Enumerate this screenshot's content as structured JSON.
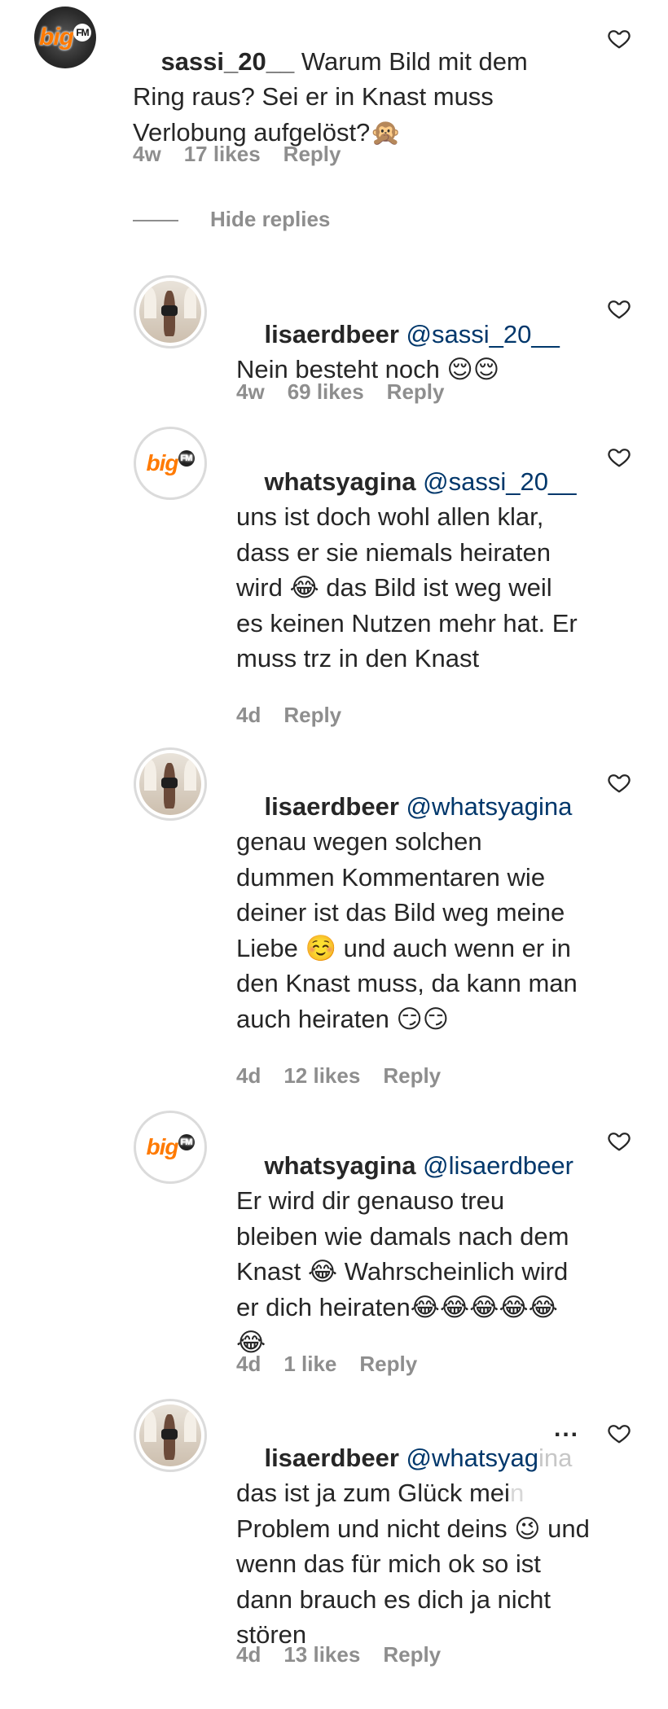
{
  "thread": {
    "root": {
      "username": "sassi_20__",
      "avatar_label": "big",
      "avatar_badge": "FM",
      "text": "Warum Bild mit dem Ring raus? Sei er in Knast muss Verlobung aufgelöst?🙊",
      "time": "4w",
      "likes": "17 likes",
      "reply": "Reply"
    },
    "hide_replies": "Hide replies",
    "replies": [
      {
        "username": "lisaerdbeer",
        "mention": "@sassi_20__",
        "text": "Nein besteht noch 😌😌",
        "time": "4w",
        "likes": "69 likes",
        "reply": "Reply"
      },
      {
        "username": "whatsyagina",
        "avatar_label": "big",
        "avatar_badge": "FM",
        "mention": "@sassi_20__",
        "text": "uns ist doch wohl allen klar, dass er sie niemals heiraten wird 😂 das Bild ist weg weil es keinen Nutzen mehr hat. Er muss trz in den Knast",
        "time": "4d",
        "likes": "",
        "reply": "Reply"
      },
      {
        "username": "lisaerdbeer",
        "mention": "@whatsyagina",
        "text": "genau wegen solchen dummen Kommentaren wie deiner ist das Bild weg meine Liebe ☺️ und auch wenn er in den Knast muss, da kann man auch heiraten 😏😏",
        "time": "4d",
        "likes": "12 likes",
        "reply": "Reply"
      },
      {
        "username": "whatsyagina",
        "avatar_label": "big",
        "avatar_badge": "FM",
        "mention": "@lisaerdbeer",
        "text": "Er wird dir genauso treu bleiben wie damals nach dem Knast 😂 Wahrscheinlich wird er dich heiraten😂😂😂😂😂😂",
        "time": "4d",
        "likes": "1 like",
        "reply": "Reply"
      },
      {
        "username": "lisaerdbeer",
        "mention": "@whatsyag",
        "mention_faded": "ina",
        "more": "...",
        "text": "das ist ja zum Glück mei",
        "text_faded": "n",
        "text_rest": "Problem und nicht deins 😉 und wenn das für mich ok so ist dann brauch es dich ja nicht stören",
        "time": "4d",
        "likes": "13 likes",
        "reply": "Reply"
      }
    ]
  }
}
